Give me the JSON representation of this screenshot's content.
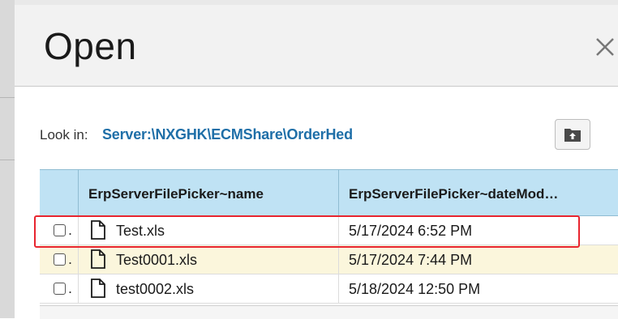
{
  "dialog": {
    "title": "Open",
    "close_icon": "close-icon"
  },
  "lookin": {
    "label": "Look in:",
    "path": "Server:\\NXGHK\\ECMShare\\OrderHed",
    "up_folder_icon": "folder-up-icon"
  },
  "grid": {
    "columns": [
      {
        "label": ""
      },
      {
        "label": "ErpServerFilePicker~name"
      },
      {
        "label": "ErpServerFilePicker~dateMod…"
      }
    ],
    "rows": [
      {
        "name": "Test.xls",
        "date": "5/17/2024 6:52 PM",
        "bg": "#ffffff"
      },
      {
        "name": "Test0001.xls",
        "date": "5/17/2024 7:44 PM",
        "bg": "#fbf6dc"
      },
      {
        "name": "test0002.xls",
        "date": "5/18/2024 12:50 PM",
        "bg": "#ffffff"
      }
    ]
  },
  "colors": {
    "header_bg": "#bfe2f4",
    "link": "#1f6fa8",
    "highlight_border": "#e8252f",
    "alt_row": "#fbf6dc"
  }
}
